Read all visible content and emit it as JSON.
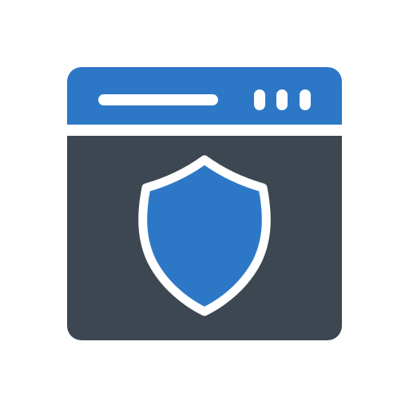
{
  "icon": {
    "name": "secure-browser-window-icon",
    "colors": {
      "background": "#ffffff",
      "title_bar": "#2d78c6",
      "window_body": "#3d4751",
      "shield_fill": "#2d78c6",
      "shield_outline": "#ffffff",
      "title_bar_details": "#ffffff"
    },
    "title_bar": {
      "address_bar_icon": "address-bar-line-icon",
      "window_control_icons": [
        "window-dot-icon",
        "window-dot-icon",
        "window-dot-icon"
      ]
    },
    "body": {
      "center_icon": "shield-icon"
    }
  }
}
